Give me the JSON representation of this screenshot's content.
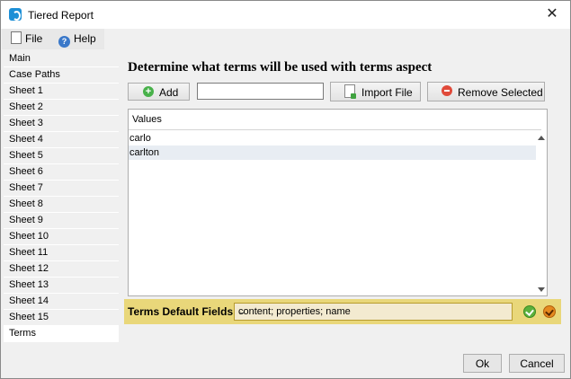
{
  "window": {
    "title": "Tiered Report"
  },
  "menu": {
    "file": "File",
    "help": "Help"
  },
  "sidebar": {
    "items": [
      "Main",
      "Case Paths",
      "Sheet 1",
      "Sheet 2",
      "Sheet 3",
      "Sheet 4",
      "Sheet 5",
      "Sheet 6",
      "Sheet 7",
      "Sheet 8",
      "Sheet 9",
      "Sheet 10",
      "Sheet 11",
      "Sheet 12",
      "Sheet 13",
      "Sheet 14",
      "Sheet 15",
      "Terms"
    ],
    "selected": "Terms"
  },
  "content": {
    "heading": "Determine what terms will be used with terms aspect",
    "add_label": "Add",
    "term_input_value": "",
    "import_label": "Import File",
    "remove_label": "Remove Selected",
    "table": {
      "header": "Values",
      "rows": [
        "carlo",
        "carlton"
      ]
    },
    "defaults": {
      "label": "Terms Default Fields",
      "value": "content; properties; name"
    }
  },
  "footer": {
    "ok": "Ok",
    "cancel": "Cancel"
  },
  "icons": {
    "app": "app-icon",
    "close": "close-icon",
    "file": "file-icon",
    "help": "help-icon",
    "add": "add-icon",
    "import": "import-file-icon",
    "remove": "remove-icon",
    "accept": "check-green-icon",
    "reject": "check-orange-icon"
  },
  "colors": {
    "accent": "#1d8fd6",
    "defaults_bar": "#e9d77a",
    "selected_row": "#e8edf3"
  }
}
